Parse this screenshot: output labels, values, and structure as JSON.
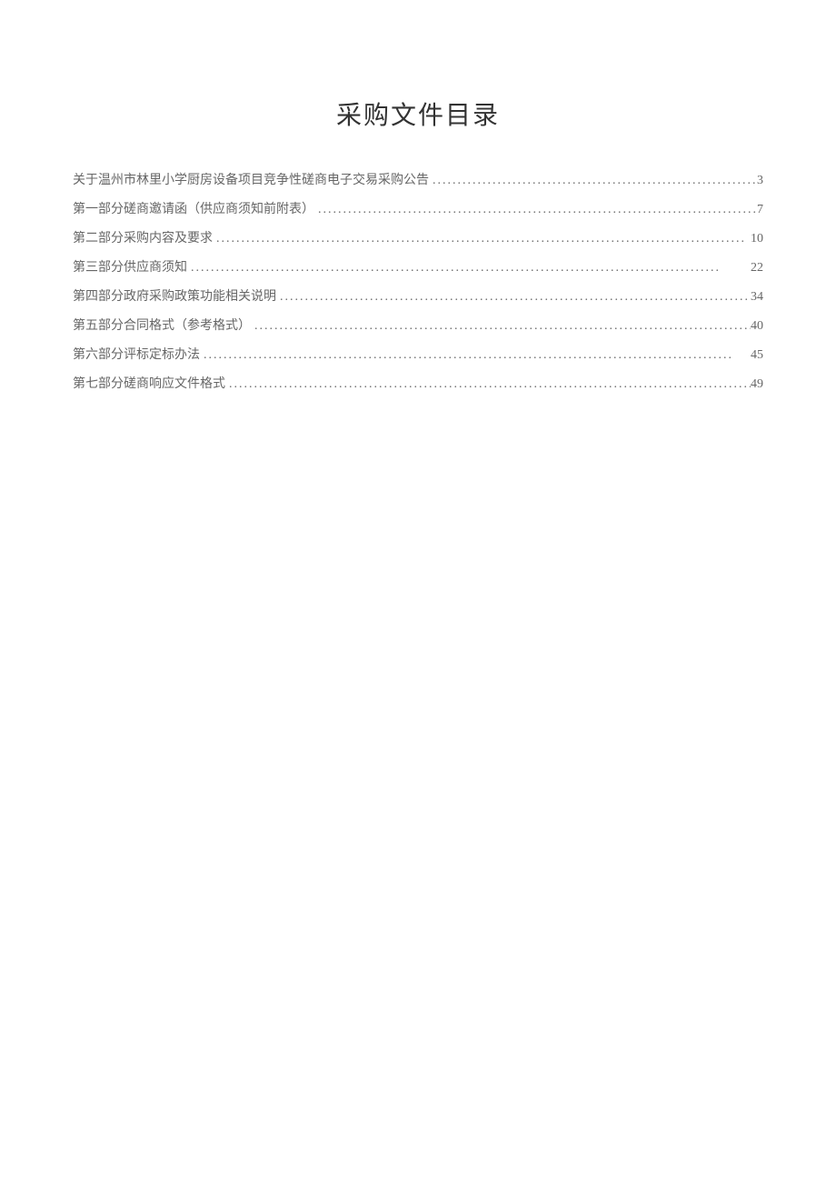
{
  "title": "采购文件目录",
  "toc": [
    {
      "label": "关于温州市林里小学厨房设备项目竞争性磋商电子交易采购公告",
      "page": "3"
    },
    {
      "label": "第一部分磋商邀请函（供应商须知前附表）",
      "page": "7"
    },
    {
      "label": "第二部分采购内容及要求",
      "page": "10"
    },
    {
      "label": "第三部分供应商须知",
      "page": "22"
    },
    {
      "label": "第四部分政府采购政策功能相关说明",
      "page": "34"
    },
    {
      "label": "第五部分合同格式（参考格式）",
      "page": "40"
    },
    {
      "label": "第六部分评标定标办法",
      "page": "45"
    },
    {
      "label": "第七部分磋商响应文件格式",
      "page": "49"
    }
  ]
}
